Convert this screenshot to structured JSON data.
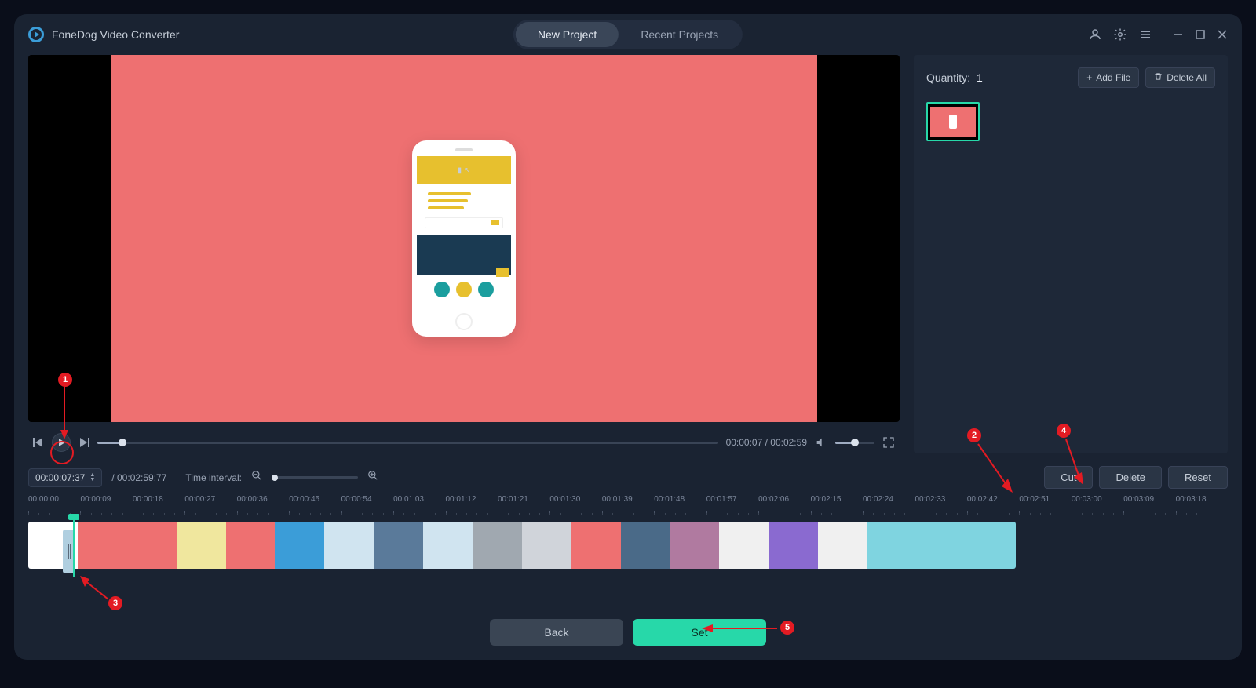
{
  "app": {
    "title": "FoneDog Video Converter"
  },
  "tabs": {
    "new_project": "New Project",
    "recent_projects": "Recent Projects"
  },
  "playback": {
    "current_time": "00:00:07",
    "total_time": "00:02:59",
    "time_display": "00:00:07 / 00:02:59",
    "progress_pct": 4
  },
  "side": {
    "quantity_label": "Quantity:",
    "quantity_value": "1",
    "add_file": "Add File",
    "delete_all": "Delete All"
  },
  "strip": {
    "current_frame": "00:00:07:37",
    "duration": "/ 00:02:59:77",
    "interval_label": "Time interval:"
  },
  "actions": {
    "cut": "Cut",
    "delete": "Delete",
    "reset": "Reset",
    "back": "Back",
    "set": "Set"
  },
  "ruler": [
    "00:00:00",
    "00:00:09",
    "00:00:18",
    "00:00:27",
    "00:00:36",
    "00:00:45",
    "00:00:54",
    "00:01:03",
    "00:01:12",
    "00:01:21",
    "00:01:30",
    "00:01:39",
    "00:01:48",
    "00:01:57",
    "00:02:06",
    "00:02:15",
    "00:02:24",
    "00:02:33",
    "00:02:42",
    "00:02:51",
    "00:03:00",
    "00:03:09",
    "00:03:18"
  ],
  "track_colors": [
    "#ffffff",
    "#ee7071",
    "#ee7071",
    "#f0e79e",
    "#ee7071",
    "#3b9dd8",
    "#d0e4f0",
    "#5a7a9a",
    "#d0e4f0",
    "#a0a8b0",
    "#d0d4da",
    "#ee7071",
    "#4a6a88",
    "#b07aa0",
    "#f0f0f0",
    "#8a6ad0",
    "#f0f0f0",
    "#7fd4e0",
    "#7fd4e0",
    "#7fd4e0"
  ],
  "annotations": {
    "n1": "1",
    "n2": "2",
    "n3": "3",
    "n4": "4",
    "n5": "5"
  }
}
